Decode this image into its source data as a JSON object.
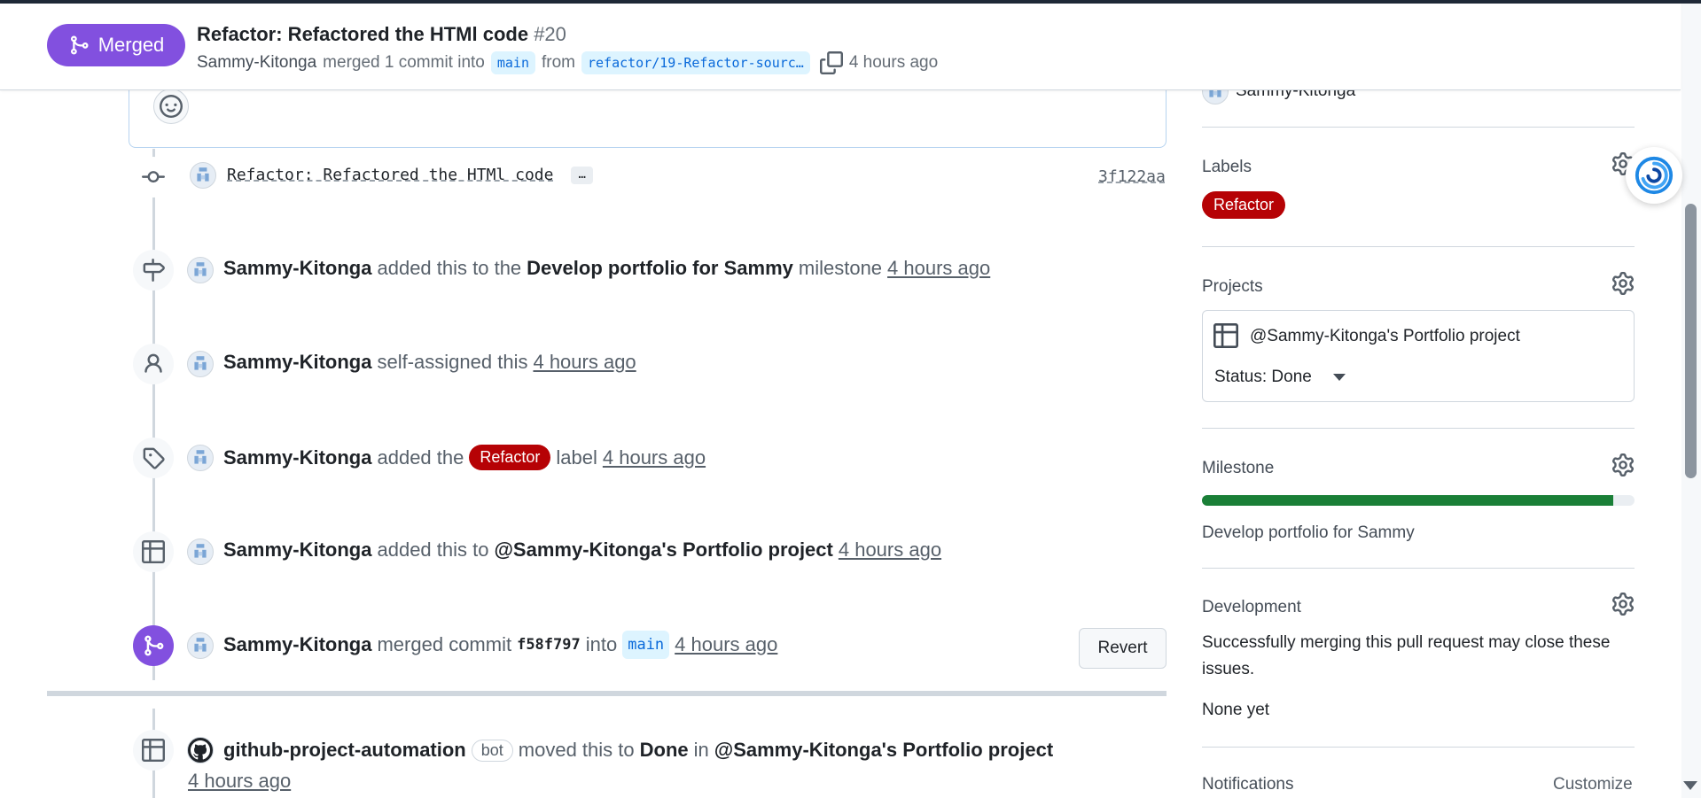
{
  "header": {
    "state_label": "Merged",
    "title": "Refactor: Refactored the HTMl code",
    "number": "#20",
    "author": "Sammy-Kitonga",
    "merge_text": "merged 1 commit into",
    "base_branch": "main",
    "from_text": "from",
    "head_branch": "refactor/19-Refactor-sourc…",
    "time": "4 hours ago"
  },
  "timeline": {
    "commit": {
      "message": "Refactor: Refactored the HTMl code",
      "ellipsis": "…",
      "sha": "3f122aa"
    },
    "milestone_event": {
      "actor": "Sammy-Kitonga",
      "text1": "added this to the",
      "milestone": "Develop portfolio for Sammy",
      "text2": "milestone",
      "time": "4 hours ago"
    },
    "assign_event": {
      "actor": "Sammy-Kitonga",
      "text": "self-assigned this",
      "time": "4 hours ago"
    },
    "label_event": {
      "actor": "Sammy-Kitonga",
      "text1": "added the",
      "label": "Refactor",
      "text2": "label",
      "time": "4 hours ago"
    },
    "project_event": {
      "actor": "Sammy-Kitonga",
      "text": "added this to",
      "project": "@Sammy-Kitonga's Portfolio project",
      "time": "4 hours ago"
    },
    "merge_event": {
      "actor": "Sammy-Kitonga",
      "text1": "merged commit",
      "sha": "f58f797",
      "text2": "into",
      "branch": "main",
      "time": "4 hours ago",
      "revert_label": "Revert"
    },
    "bot_event": {
      "actor": "github-project-automation",
      "bot_tag": "bot",
      "text1": "moved this to",
      "status": "Done",
      "text2": "in",
      "project": "@Sammy-Kitonga's Portfolio project",
      "time": "4 hours ago"
    }
  },
  "sidebar": {
    "assignee": "Sammy-Kitonga",
    "labels_heading": "Labels",
    "label": "Refactor",
    "projects_heading": "Projects",
    "project_name": "@Sammy-Kitonga's Portfolio project",
    "project_status": "Status: Done",
    "milestone_heading": "Milestone",
    "milestone_progress": 0.95,
    "milestone_name": "Develop portfolio for Sammy",
    "development_heading": "Development",
    "development_text": "Successfully merging this pull request may close these issues.",
    "development_none": "None yet",
    "notifications_heading": "Notifications",
    "customize_label": "Customize"
  },
  "colors": {
    "merged": "#8250df",
    "label_refactor": "#b60205",
    "progress": "#1a7f37",
    "link": "#0969da"
  },
  "icons": {
    "merge": "git-merge-icon",
    "copy": "copy-icon",
    "smiley": "smiley-icon",
    "commit": "git-commit-icon",
    "milestone": "milestone-icon",
    "person": "person-icon",
    "tag": "tag-icon",
    "table": "table-icon",
    "gear": "gear-icon"
  }
}
